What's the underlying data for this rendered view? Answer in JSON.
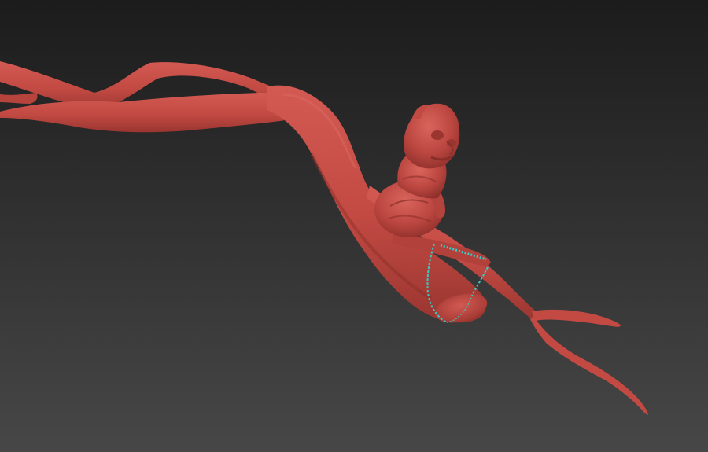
{
  "viewport": {
    "view": "perspective",
    "background_top": "#1c1c1c",
    "background_bottom": "#474747",
    "model_color": "#c24a43",
    "model_shadow": "#8e2f2a",
    "model_highlight": "#d8655c",
    "selection_color": "#39c9c4"
  },
  "scene": {
    "objects": [
      {
        "name": "tree-branch",
        "kind": "sculpted-mesh",
        "selected": false
      },
      {
        "name": "creature-figure",
        "kind": "sculpted-mesh",
        "selected": false
      },
      {
        "name": "swing-rope",
        "kind": "spline",
        "selected": true
      }
    ]
  }
}
